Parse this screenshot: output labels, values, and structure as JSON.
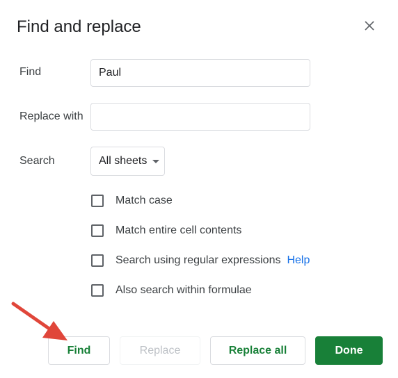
{
  "dialog": {
    "title": "Find and replace",
    "close_icon": "close-icon"
  },
  "form": {
    "find_label": "Find",
    "find_value": "Paul",
    "replace_label": "Replace with",
    "replace_value": "",
    "search_label": "Search",
    "search_scope": "All sheets"
  },
  "options": [
    {
      "label": "Match case",
      "checked": false
    },
    {
      "label": "Match entire cell contents",
      "checked": false
    },
    {
      "label": "Search using regular expressions",
      "checked": false,
      "help": "Help"
    },
    {
      "label": "Also search within formulae",
      "checked": false
    }
  ],
  "buttons": {
    "find": "Find",
    "replace": "Replace",
    "replace_all": "Replace all",
    "done": "Done"
  },
  "colors": {
    "accent_green": "#188038",
    "link_blue": "#1a73e8",
    "annotation_arrow": "#e0463a"
  }
}
